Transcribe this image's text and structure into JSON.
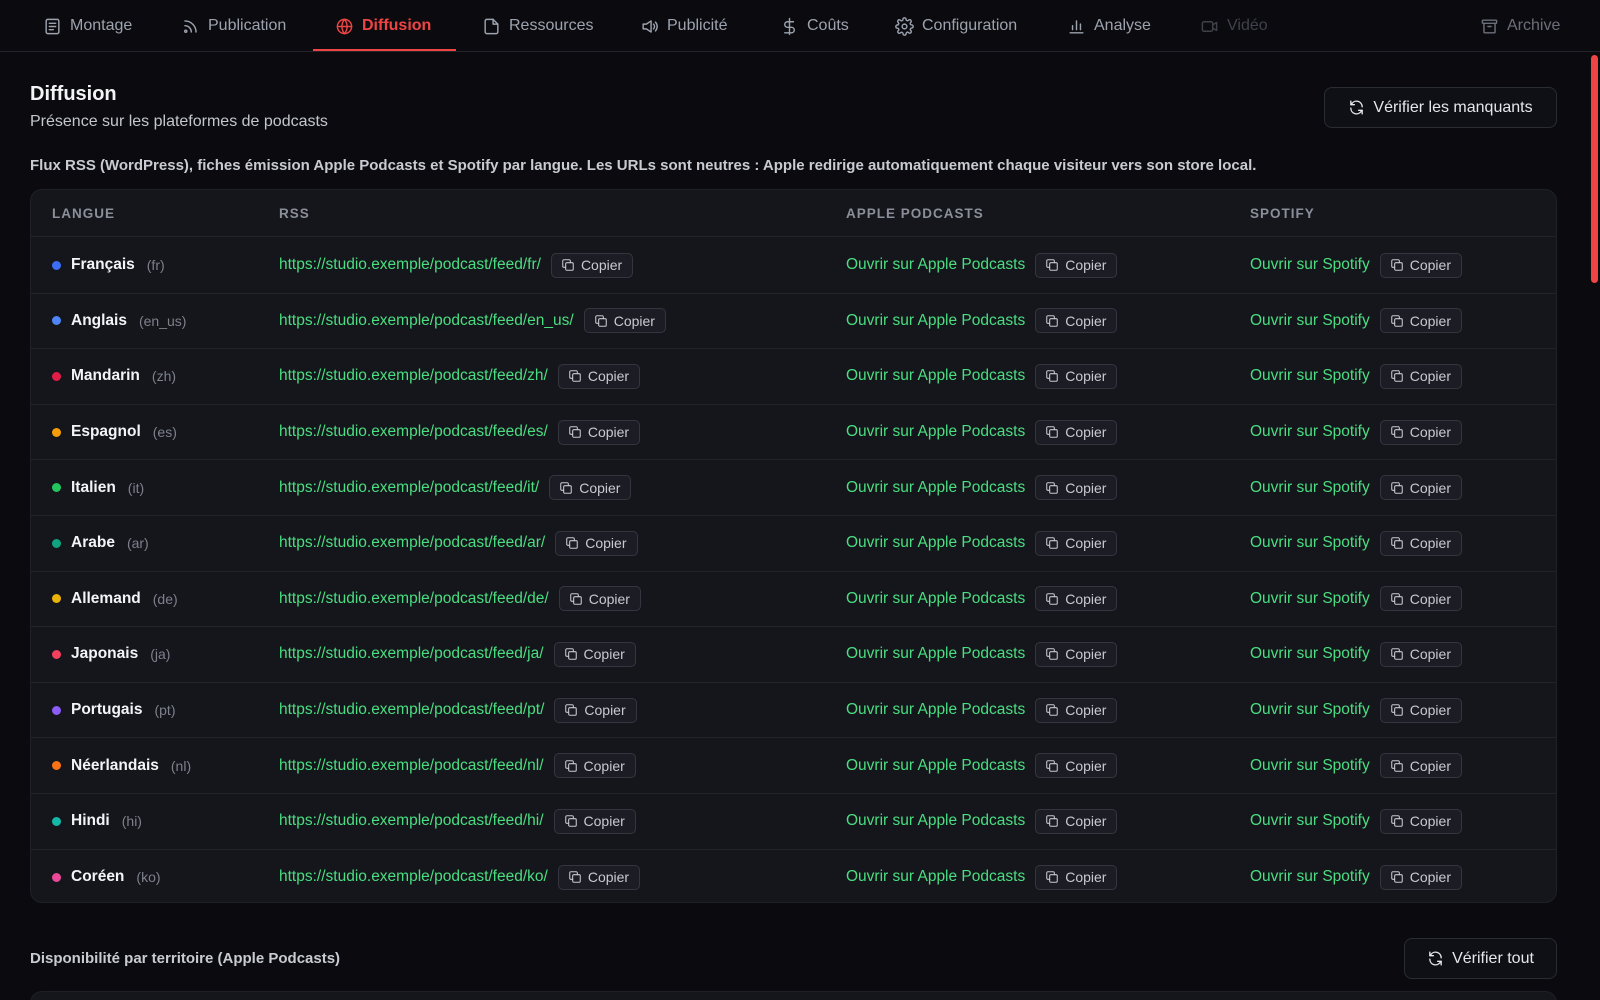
{
  "nav": {
    "tabs": [
      {
        "label": "Montage",
        "icon": "document-text-icon"
      },
      {
        "label": "Publication",
        "icon": "rss-icon"
      },
      {
        "label": "Diffusion",
        "icon": "globe-icon"
      },
      {
        "label": "Ressources",
        "icon": "file-icon"
      },
      {
        "label": "Publicité",
        "icon": "megaphone-icon"
      },
      {
        "label": "Coûts",
        "icon": "dollar-icon"
      },
      {
        "label": "Configuration",
        "icon": "gear-icon"
      },
      {
        "label": "Analyse",
        "icon": "bar-chart-icon"
      },
      {
        "label": "Vidéo",
        "icon": "video-icon"
      },
      {
        "label": "Archive",
        "icon": "archive-icon"
      }
    ],
    "active_tab": "Diffusion",
    "accent_color": "#ef4444"
  },
  "header": {
    "title": "Diffusion",
    "subtitle": "Présence sur les plateformes de podcasts",
    "check_missing_label": "Vérifier les manquants"
  },
  "description": "Flux RSS (WordPress), fiches émission Apple Podcasts et Spotify par langue. Les URLs sont neutres : Apple redirige automatiquement chaque visiteur vers son store local.",
  "table": {
    "columns": [
      "LANGUE",
      "RSS",
      "APPLE PODCASTS",
      "SPOTIFY"
    ],
    "copy_label": "Copier",
    "apple_link_label": "Ouvrir sur Apple Podcasts",
    "spotify_link_label": "Ouvrir sur Spotify",
    "rows": [
      {
        "name": "Français",
        "code": "(fr)",
        "rss": "https://studio.exemple/podcast/feed/fr/",
        "dot": "#3b6ef5"
      },
      {
        "name": "Anglais",
        "code": "(en_us)",
        "rss": "https://studio.exemple/podcast/feed/en_us/",
        "dot": "#4f86f7"
      },
      {
        "name": "Mandarin",
        "code": "(zh)",
        "rss": "https://studio.exemple/podcast/feed/zh/",
        "dot": "#e11d48"
      },
      {
        "name": "Espagnol",
        "code": "(es)",
        "rss": "https://studio.exemple/podcast/feed/es/",
        "dot": "#f59e0b"
      },
      {
        "name": "Italien",
        "code": "(it)",
        "rss": "https://studio.exemple/podcast/feed/it/",
        "dot": "#22c55e"
      },
      {
        "name": "Arabe",
        "code": "(ar)",
        "rss": "https://studio.exemple/podcast/feed/ar/",
        "dot": "#10a37f"
      },
      {
        "name": "Allemand",
        "code": "(de)",
        "rss": "https://studio.exemple/podcast/feed/de/",
        "dot": "#eab308"
      },
      {
        "name": "Japonais",
        "code": "(ja)",
        "rss": "https://studio.exemple/podcast/feed/ja/",
        "dot": "#f43f5e"
      },
      {
        "name": "Portugais",
        "code": "(pt)",
        "rss": "https://studio.exemple/podcast/feed/pt/",
        "dot": "#8b5cf6"
      },
      {
        "name": "Néerlandais",
        "code": "(nl)",
        "rss": "https://studio.exemple/podcast/feed/nl/",
        "dot": "#f97316"
      },
      {
        "name": "Hindi",
        "code": "(hi)",
        "rss": "https://studio.exemple/podcast/feed/hi/",
        "dot": "#14b8a6"
      },
      {
        "name": "Coréen",
        "code": "(ko)",
        "rss": "https://studio.exemple/podcast/feed/ko/",
        "dot": "#ec4899"
      }
    ]
  },
  "territory": {
    "title": "Disponibilité par territoire (Apple Podcasts)",
    "check_all_label": "Vérifier tout"
  }
}
